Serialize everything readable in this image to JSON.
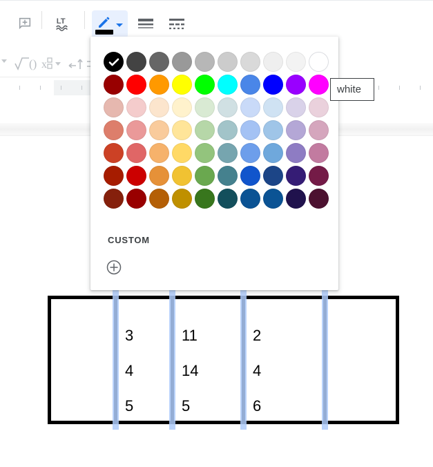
{
  "app": {
    "background": "#ffffff",
    "accent": "#1a73e8",
    "panel_bg": "#ffffff"
  },
  "toolbar": {
    "items": [
      {
        "name": "add-comment-icon",
        "label": "Add comment"
      },
      {
        "name": "languagetool-icon",
        "label": "LT"
      },
      {
        "name": "border-color-button",
        "label": "Border color"
      },
      {
        "name": "border-width-icon",
        "label": "Border width"
      },
      {
        "name": "border-dash-icon",
        "label": "Border dash"
      }
    ],
    "pen": {
      "current_color": "#000000",
      "caret": "▾"
    }
  },
  "equation_toolbar": {
    "items": [
      "√",
      "()",
      "x□□",
      "←↑⇄"
    ]
  },
  "color_panel": {
    "selected_color": "#000000",
    "selected_check": "✓",
    "custom_label": "CUSTOM",
    "custom_add_glyph": "+",
    "rows": [
      [
        "#000000",
        "#434343",
        "#666666",
        "#999999",
        "#b7b7b7",
        "#cccccc",
        "#d9d9d9",
        "#efefef",
        "#f3f3f3",
        "#ffffff"
      ],
      [
        "#980000",
        "#ff0000",
        "#ff9900",
        "#ffff00",
        "#00ff00",
        "#00ffff",
        "#4a86e8",
        "#0000ff",
        "#9900ff",
        "#ff00ff"
      ],
      [
        "#e6b8af",
        "#f4cccc",
        "#fce5cd",
        "#fff2cc",
        "#d9ead3",
        "#d0e0e3",
        "#c9daf8",
        "#cfe2f3",
        "#d9d2e9",
        "#ead1dc"
      ],
      [
        "#dd7e6b",
        "#ea9999",
        "#f9cb9c",
        "#ffe599",
        "#b6d7a8",
        "#a2c4c9",
        "#a4c2f4",
        "#9fc5e8",
        "#b4a7d6",
        "#d5a6bd"
      ],
      [
        "#cc4125",
        "#e06666",
        "#f6b26b",
        "#ffd966",
        "#93c47d",
        "#76a5af",
        "#6d9eeb",
        "#6fa8dc",
        "#8e7cc3",
        "#c27ba0"
      ],
      [
        "#a61c00",
        "#cc0000",
        "#e69138",
        "#f1c232",
        "#6aa84f",
        "#45818e",
        "#1155cc",
        "#1c4587",
        "#351c75",
        "#741b47"
      ],
      [
        "#85200c",
        "#990000",
        "#b45f06",
        "#bf9000",
        "#38761d",
        "#134f5c",
        "#0b5394",
        "#0b5394",
        "#20124d",
        "#4c1130"
      ]
    ]
  },
  "tooltip": {
    "text": "white"
  },
  "table": {
    "border_color": "#000000",
    "handle_color": "#aecbfa",
    "columns": 5,
    "column_values": [
      [],
      [
        "3",
        "4",
        "5"
      ],
      [
        "11",
        "14",
        "5"
      ],
      [
        "2",
        "4",
        "6"
      ],
      []
    ]
  },
  "ruler": {
    "ticks": 14
  }
}
